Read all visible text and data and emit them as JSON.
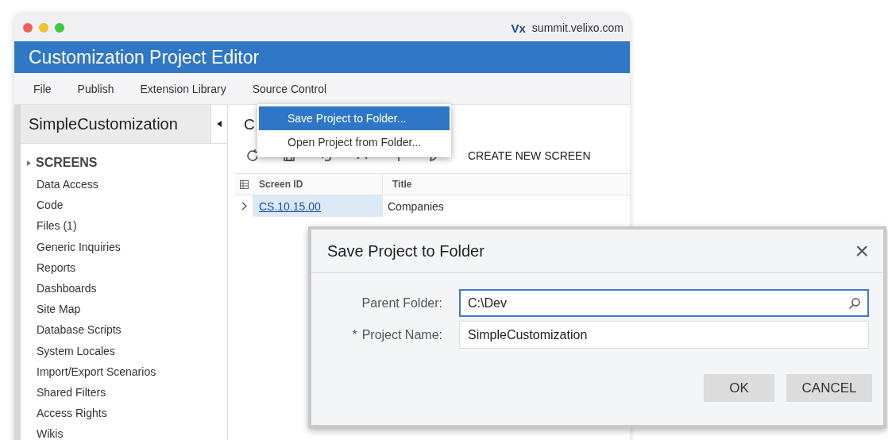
{
  "browser": {
    "logo": "Vx",
    "address": "summit.velixo.com"
  },
  "app_title": "Customization Project Editor",
  "menu_bar": [
    {
      "label": "File"
    },
    {
      "label": "Publish"
    },
    {
      "label": "Extension Library"
    },
    {
      "label": "Source Control"
    }
  ],
  "dropdown": [
    {
      "label": "Save Project to Folder...",
      "selected": true
    },
    {
      "label": "Open Project from Folder...",
      "selected": false
    }
  ],
  "sidebar": {
    "project": "SimpleCustomization",
    "items": [
      {
        "label": "SCREENS",
        "kind": "group"
      },
      {
        "label": "Data Access",
        "kind": "item"
      },
      {
        "label": "Code",
        "kind": "item"
      },
      {
        "label": "Files (1)",
        "kind": "item"
      },
      {
        "label": "Generic Inquiries",
        "kind": "item"
      },
      {
        "label": "Reports",
        "kind": "item"
      },
      {
        "label": "Dashboards",
        "kind": "item"
      },
      {
        "label": "Site Map",
        "kind": "item"
      },
      {
        "label": "Database Scripts",
        "kind": "item"
      },
      {
        "label": "System Locales",
        "kind": "item"
      },
      {
        "label": "Import/Export Scenarios",
        "kind": "item"
      },
      {
        "label": "Shared Filters",
        "kind": "item"
      },
      {
        "label": "Access Rights",
        "kind": "item"
      },
      {
        "label": "Wikis",
        "kind": "item"
      }
    ]
  },
  "main": {
    "heading": "C",
    "create_button": "CREATE NEW SCREEN",
    "table": {
      "columns": [
        "Screen ID",
        "Title"
      ],
      "rows": [
        {
          "screen_id": "CS.10.15.00",
          "title": "Companies",
          "selected": true
        }
      ]
    }
  },
  "dialog": {
    "title": "Save Project to Folder",
    "close": "×",
    "fields": [
      {
        "label": "Parent Folder:",
        "value": "C:\\Dev",
        "required": false,
        "focused": true,
        "kind": "lookup"
      },
      {
        "label": "Project Name:",
        "value": "SimpleCustomization",
        "required": true,
        "focused": false,
        "kind": "text"
      }
    ],
    "required_mark": "*",
    "buttons": [
      "OK",
      "CANCEL"
    ]
  }
}
